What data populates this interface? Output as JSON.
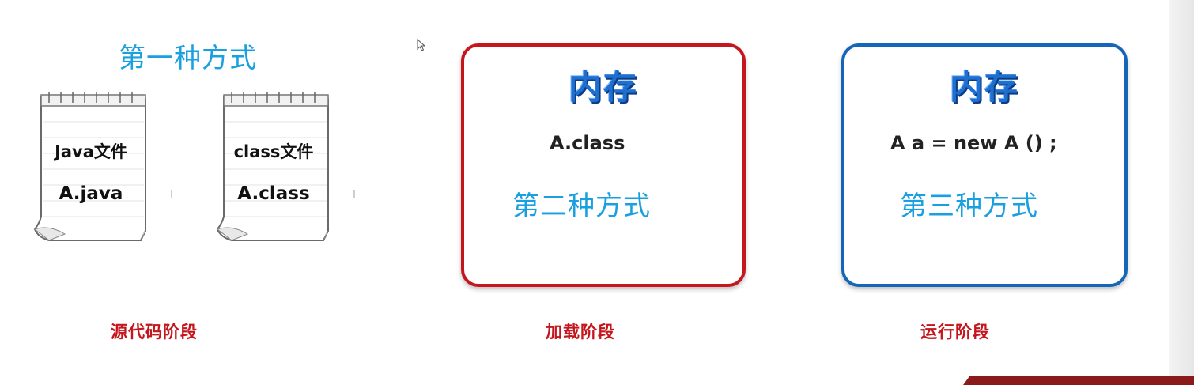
{
  "methods": {
    "first": "第一种方式",
    "second": "第二种方式",
    "third": "第三种方式"
  },
  "notepads": [
    {
      "line1": "Java文件",
      "line2": "A.java"
    },
    {
      "line1": "class文件",
      "line2": "A.class"
    }
  ],
  "memory_boxes": [
    {
      "title": "内存",
      "body": "A.class",
      "border_color": "#c4161c"
    },
    {
      "title": "内存",
      "body": "A a =  new A () ;",
      "border_color": "#1565b8"
    }
  ],
  "stages": {
    "source": "源代码阶段",
    "loading": "加载阶段",
    "runtime": "运行阶段"
  },
  "colors": {
    "method_blue": "#1aa0e0",
    "stage_red": "#c4161c",
    "memory_title_blue": "#1e6fd0"
  },
  "icons": {
    "cursor": "mouse-pointer-icon",
    "notepad": "spiral-notepad-icon"
  }
}
